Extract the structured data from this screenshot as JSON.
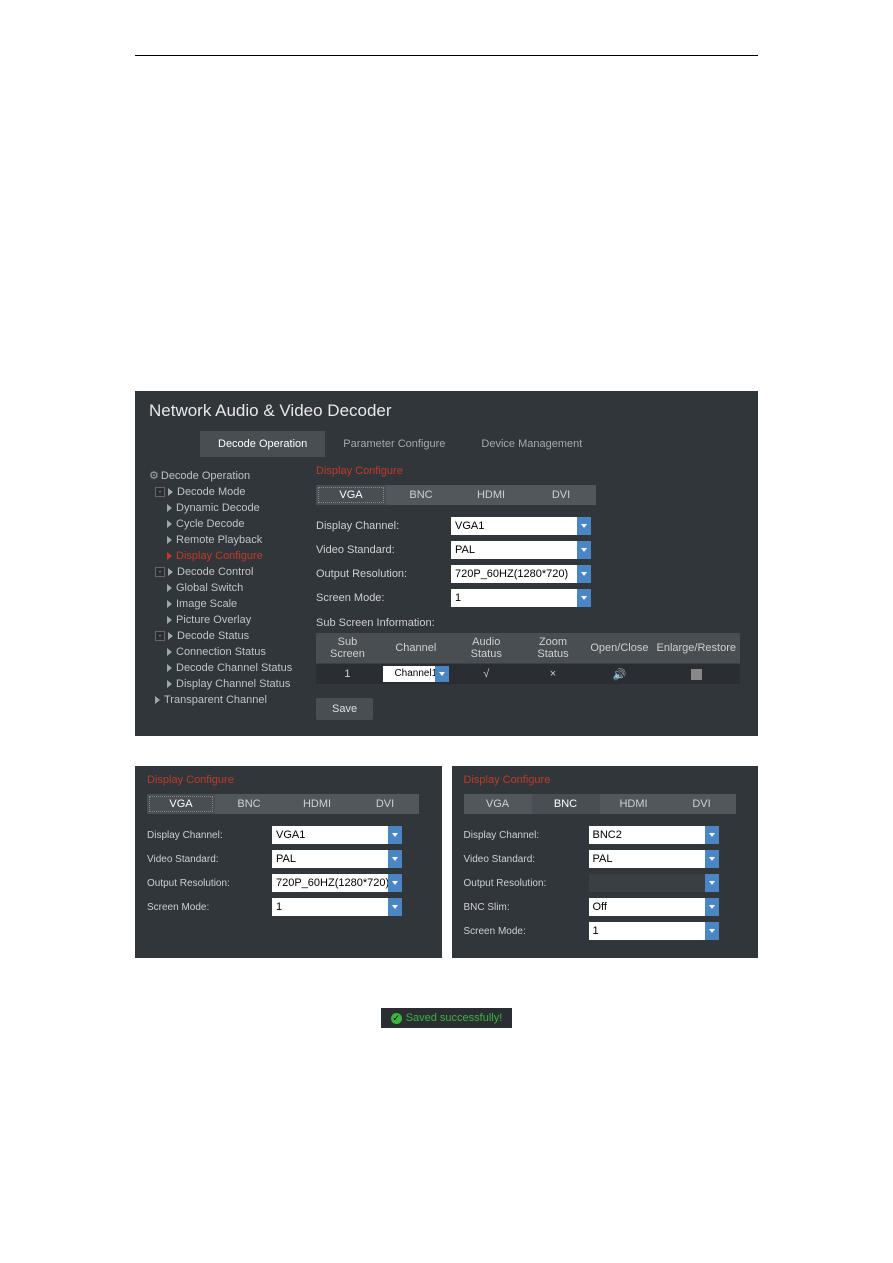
{
  "app_title": "Network Audio & Video Decoder",
  "tabs": [
    "Decode Operation",
    "Parameter Configure",
    "Device Management"
  ],
  "sidebar": {
    "root": "Decode Operation",
    "g1": "Decode Mode",
    "g1_items": [
      "Dynamic Decode",
      "Cycle Decode",
      "Remote Playback",
      "Display Configure"
    ],
    "g2": "Decode Control",
    "g2_items": [
      "Global Switch",
      "Image Scale",
      "Picture Overlay"
    ],
    "g3": "Decode Status",
    "g3_items": [
      "Connection Status",
      "Decode Channel Status",
      "Display Channel Status"
    ],
    "g4": "Transparent Channel"
  },
  "section": "Display Configure",
  "pills": [
    "VGA",
    "BNC",
    "HDMI",
    "DVI"
  ],
  "fields": {
    "display_channel_l": "Display Channel:",
    "display_channel": "VGA1",
    "video_std_l": "Video Standard:",
    "video_std": "PAL",
    "out_res_l": "Output Resolution:",
    "out_res": "720P_60HZ(1280*720)",
    "screen_mode_l": "Screen Mode:",
    "screen_mode": "1",
    "bnc_slim_l": "BNC Slim:",
    "bnc_slim": "Off",
    "bnc_channel": "BNC2"
  },
  "sub_hdr": "Sub Screen Information:",
  "tbl_hdr": [
    "Sub Screen",
    "Channel",
    "Audio Status",
    "Zoom Status",
    "Open/Close",
    "Enlarge/Restore"
  ],
  "tbl_row": {
    "sub": "1",
    "chn": "Channel1",
    "audio": "√",
    "zoom": "×"
  },
  "save": "Save",
  "saved_msg": "Saved successfully!"
}
